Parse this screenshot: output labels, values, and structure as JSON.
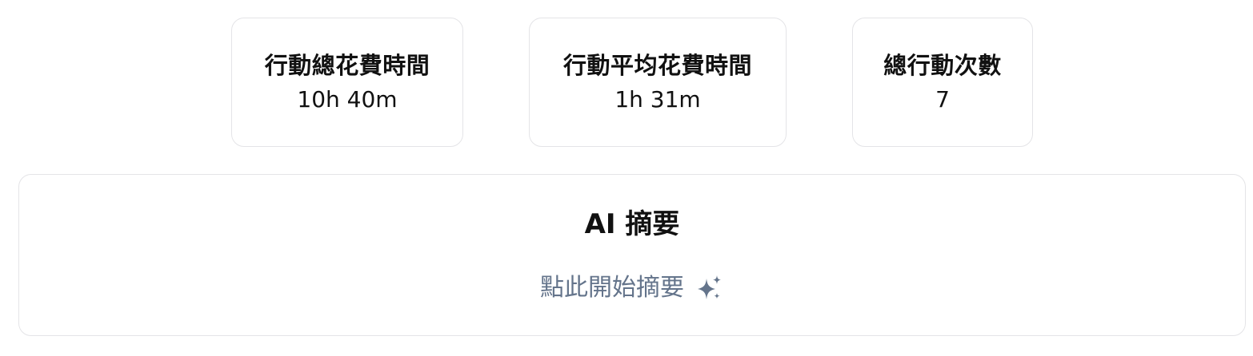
{
  "stats": [
    {
      "label": "行動總花費時間",
      "value": "10h 40m"
    },
    {
      "label": "行動平均花費時間",
      "value": "1h 31m"
    },
    {
      "label": "總行動次數",
      "value": "7"
    }
  ],
  "summary": {
    "title": "AI 摘要",
    "action_label": "點此開始摘要",
    "action_icon": "sparkles-icon"
  },
  "colors": {
    "border": "#e4e4e7",
    "text": "#111111",
    "muted": "#64748b"
  }
}
